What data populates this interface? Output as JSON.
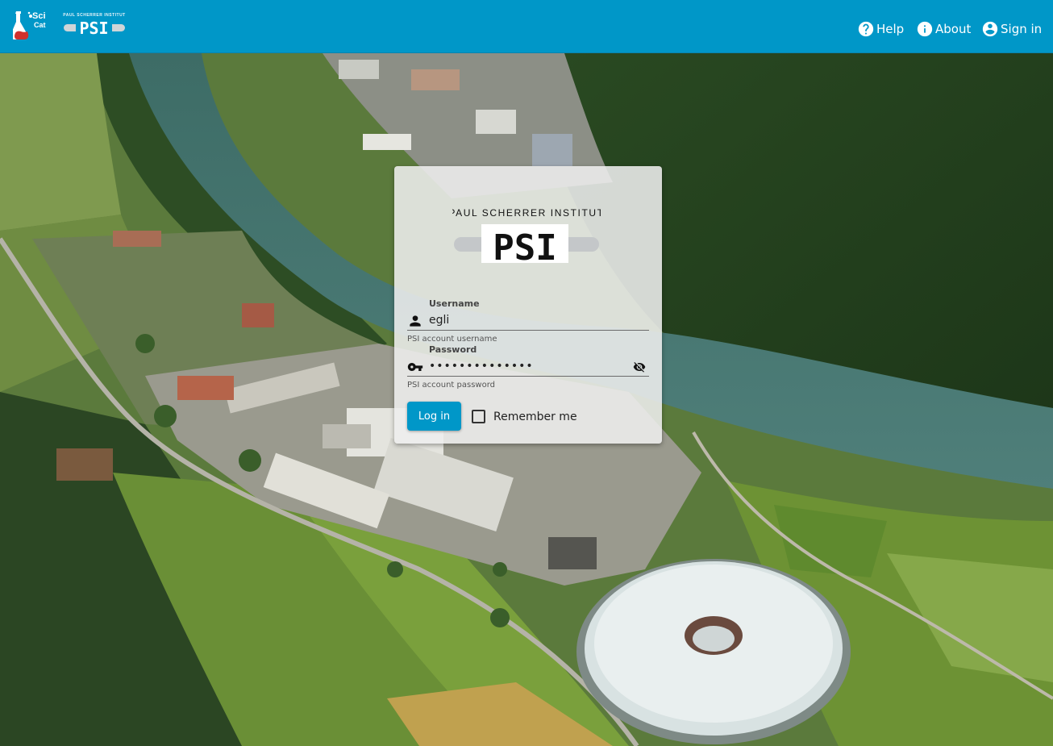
{
  "header": {
    "logo_text_top": "Sci",
    "logo_text_bottom": "Cat",
    "institute_mini": "PAUL SCHERRER INSTITUT",
    "psi_mini": "PSI",
    "help_label": "Help",
    "about_label": "About",
    "signin_label": "Sign in"
  },
  "login": {
    "institute_name": "PAUL SCHERRER INSTITUT",
    "institute_short": "PSI",
    "username": {
      "label": "Username",
      "value": "egli",
      "hint": "PSI account username"
    },
    "password": {
      "label": "Password",
      "value": "••••••••••••••",
      "hint": "PSI account password"
    },
    "login_button": "Log in",
    "remember_label": "Remember me",
    "remember_checked": false
  },
  "colors": {
    "primary": "#0097c8",
    "card_bg": "#eeeeee"
  },
  "icons": [
    "help-circle-icon",
    "info-circle-icon",
    "account-circle-icon",
    "person-icon",
    "key-icon",
    "visibility-off-icon"
  ]
}
